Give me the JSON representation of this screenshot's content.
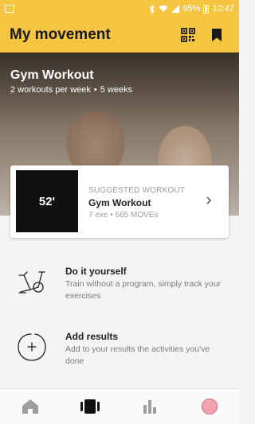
{
  "status_bar": {
    "battery": "95%",
    "time": "10:47"
  },
  "app_bar": {
    "title": "My movement",
    "actions": [
      "qr-code-icon",
      "bookmark-icon"
    ]
  },
  "hero": {
    "title": "Gym Workout",
    "frequency": "2 workouts per week",
    "separator": "•",
    "duration": "5 weeks"
  },
  "suggested": {
    "thumb_time": "52'",
    "label": "SUGGESTED WORKOUT",
    "title": "Gym Workout",
    "exercises": "7 exe",
    "separator": "•",
    "moves": "665 MOVEs"
  },
  "options": [
    {
      "icon": "exercise-bike-icon",
      "title": "Do it yourself",
      "description": "Train without a program, simply track your exercises"
    },
    {
      "icon": "add-circle-icon",
      "title": "Add results",
      "description": "Add to your results the activities you've done"
    }
  ],
  "bottom_nav": [
    {
      "icon": "home-icon",
      "active": false
    },
    {
      "icon": "workouts-icon",
      "active": true
    },
    {
      "icon": "stats-icon",
      "active": false
    },
    {
      "icon": "profile-icon",
      "active": false
    }
  ],
  "colors": {
    "accent": "#f5c542",
    "nav_inactive": "#9e9e9e",
    "nav_active": "#111111",
    "profile": "#f2a3ad"
  }
}
